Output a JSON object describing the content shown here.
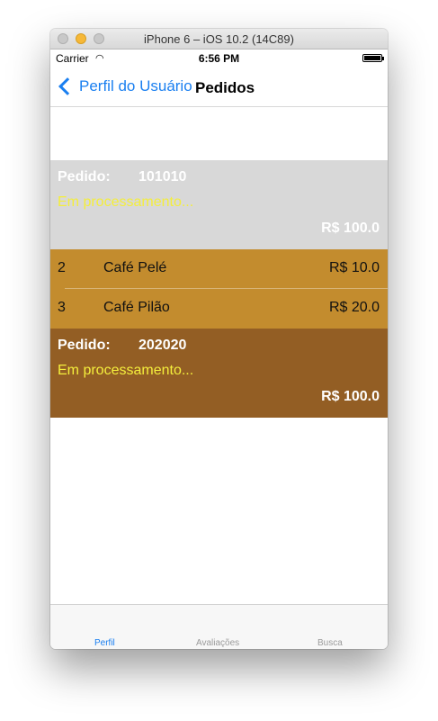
{
  "window": {
    "title": "iPhone 6 – iOS 10.2 (14C89)"
  },
  "status_bar": {
    "carrier": "Carrier",
    "time": "6:56 PM"
  },
  "nav": {
    "back_label": "Perfil do Usuário",
    "title": "Pedidos"
  },
  "orders": [
    {
      "label": "Pedido:",
      "number": "101010",
      "status": "Em processamento...",
      "total": "R$ 100.0",
      "color": "#d8d8d8"
    },
    {
      "label": "Pedido:",
      "number": "202020",
      "status": "Em processamento...",
      "total": "R$ 100.0",
      "color": "#935e24"
    }
  ],
  "items": [
    {
      "qty": "2",
      "name": "Café Pelé",
      "price": "R$ 10.0"
    },
    {
      "qty": "3",
      "name": "Café Pilão",
      "price": "R$ 20.0"
    }
  ],
  "tabs": [
    {
      "label": "Perfil",
      "active": true
    },
    {
      "label": "Avaliações",
      "active": false
    },
    {
      "label": "Busca",
      "active": false
    }
  ],
  "colors": {
    "accent": "#1a7ff0",
    "status_text": "#f4ee3c",
    "item_bg": "#c38c2e"
  }
}
